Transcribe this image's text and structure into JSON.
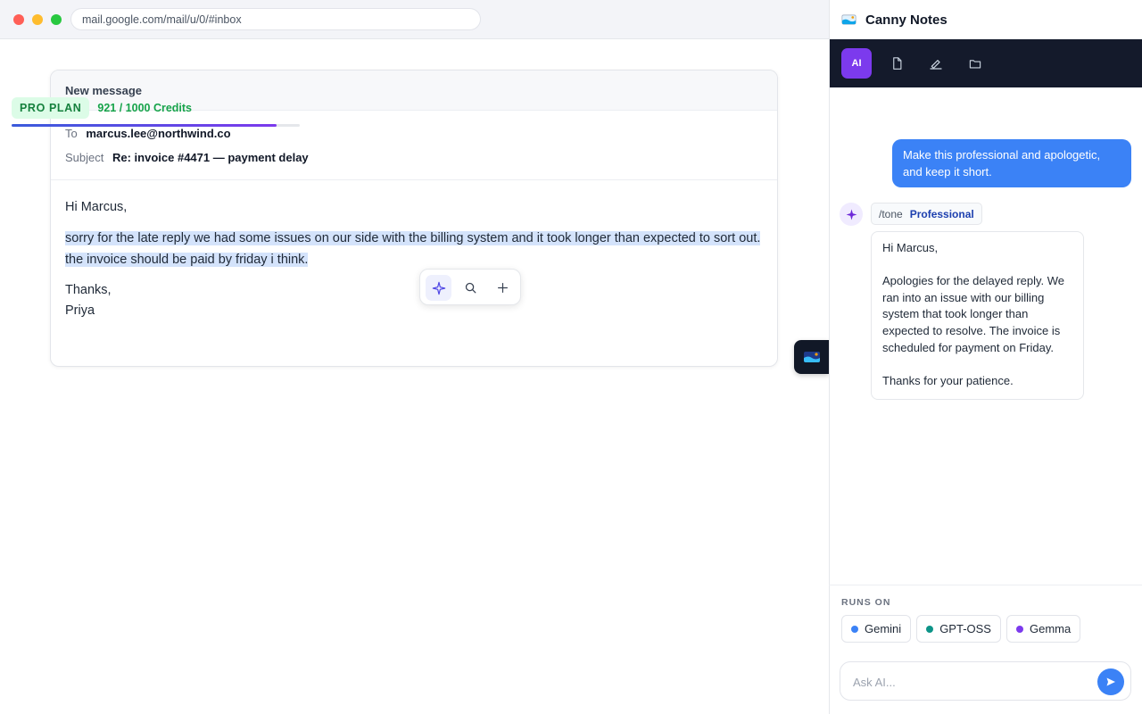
{
  "browser": {
    "url": "mail.google.com/mail/u/0/#inbox"
  },
  "compose": {
    "header": "New message",
    "to_label": "To",
    "to_value": "marcus.lee@northwind.co",
    "subject_label": "Subject",
    "subject_value": "Re: invoice #4471 — payment delay",
    "greeting": "Hi Marcus,",
    "selected_text": "sorry for the late reply we had some issues on our side with the billing system and it took longer than expected to sort out. the invoice should be paid by friday i think.",
    "signoff": "Thanks,",
    "signature": "Priya"
  },
  "floating_toolbar": {
    "icons": [
      "sparkle-icon",
      "search-icon",
      "plus-icon"
    ]
  },
  "sidebar": {
    "title": "Canny Notes",
    "toolbar": {
      "ai_label": "AI",
      "icons": [
        "document-icon",
        "highlighter-icon",
        "folder-icon"
      ]
    },
    "plan": {
      "badge": "PRO PLAN",
      "credits": "921 / 1000 Credits",
      "used_fraction": 0.921
    },
    "chat": {
      "user_message": "Make this professional and apologetic, and keep it short.",
      "tone_command": "/tone",
      "tone_value": "Professional",
      "reply": "Hi Marcus,\n\nApologies for the delayed reply. We ran into an issue with our billing system that took longer than expected to resolve. The invoice is scheduled for payment on Friday.\n\nThanks for your patience."
    },
    "runs_on": {
      "label": "RUNS ON",
      "models": [
        {
          "name": "Gemini",
          "color": "#3b82f6"
        },
        {
          "name": "GPT-OSS",
          "color": "#0d9488"
        },
        {
          "name": "Gemma",
          "color": "#7c3aed"
        }
      ]
    },
    "ask": {
      "placeholder": "Ask AI..."
    }
  },
  "colors": {
    "accent": "#3b82f6",
    "ai_purple": "#7c3aed",
    "plan_green": "#16a34a",
    "toolbar_dark": "#141a2b"
  }
}
